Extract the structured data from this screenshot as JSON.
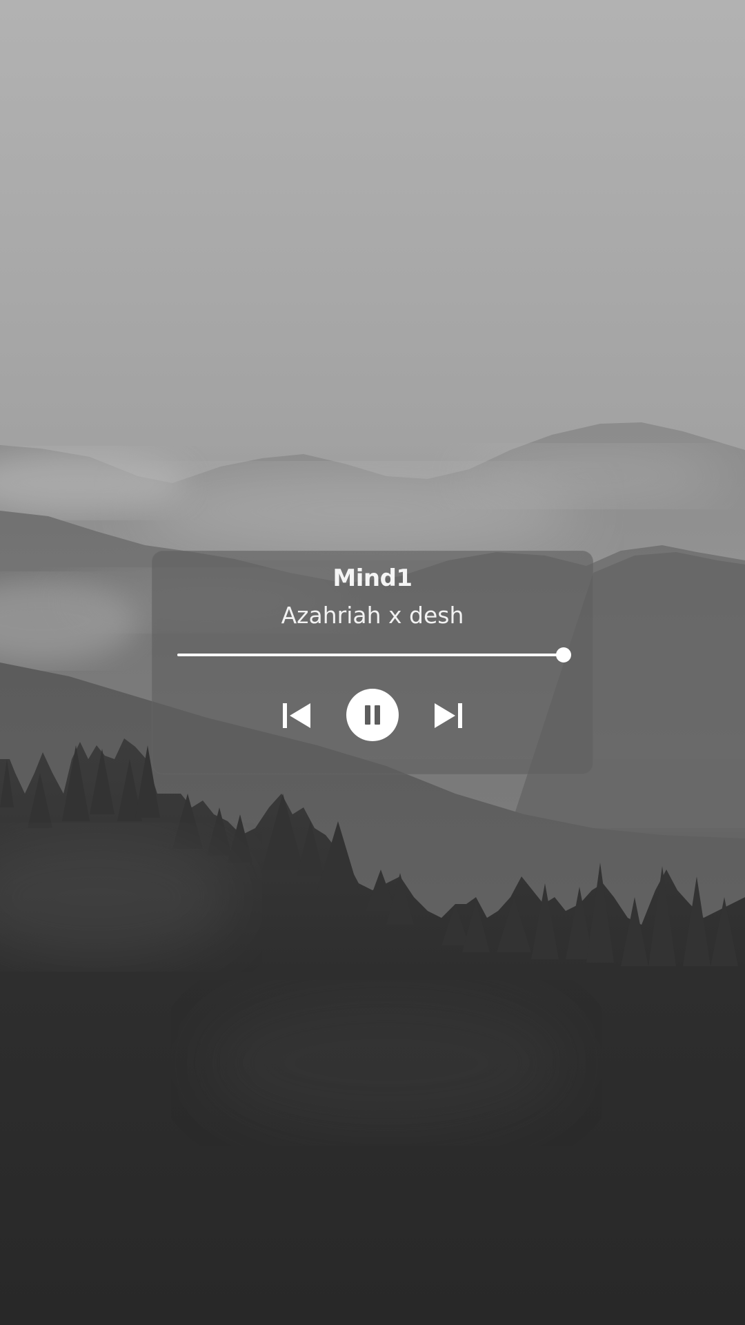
{
  "player": {
    "title": "Mind1",
    "artist": "Azahriah x desh",
    "progress": 1.0,
    "controls": {
      "previous_icon": "skip-previous-icon",
      "play_pause_icon": "pause-icon",
      "next_icon": "skip-next-icon"
    },
    "state": "playing"
  },
  "colors": {
    "text": "#ffffff",
    "card_background": "rgba(95,95,95,0.62)",
    "accent": "#ffffff"
  },
  "background": {
    "icon": "misty-mountains-forest-photo"
  }
}
